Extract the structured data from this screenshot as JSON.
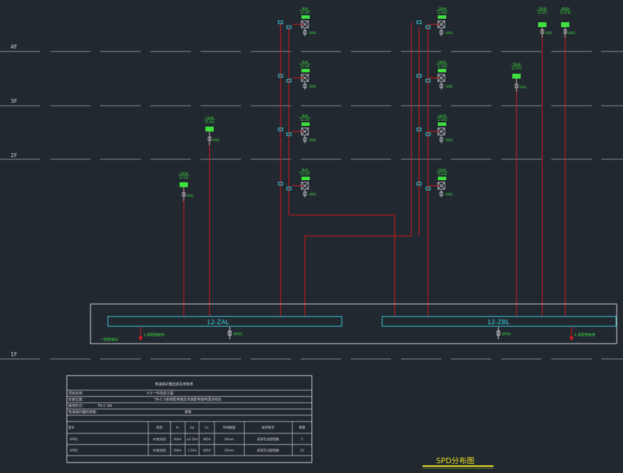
{
  "floors": [
    "4F",
    "3F",
    "2F",
    "1F"
  ],
  "bus_left": "12-ZAL",
  "bus_right": "12-ZBL",
  "tags": {
    "left_room": "1-变配电房用",
    "left_spd": "SPD1",
    "right_spd": "SPD1",
    "right_room": "1-变配电房用",
    "left_note": "一层配电间"
  },
  "boxes": {
    "b1": {
      "kw": "9kW",
      "id": "12-3AT",
      "spd": "SPD2"
    },
    "b2": {
      "kw": "9kW",
      "id": "12-3AT",
      "spd": "SPD2"
    },
    "b3": {
      "kw": "9kW",
      "id": "12-2AT",
      "spd": "SPD2"
    },
    "b4": {
      "kw": "9kW",
      "id": "12-1AT",
      "spd": "SPD2"
    },
    "b5": {
      "kw": "20kW",
      "id": "12-4AE",
      "spd": "SPD2"
    },
    "b6": {
      "kw": "20kW",
      "id": "12-3AE",
      "spd": "SPD2"
    },
    "b7": {
      "kw": "20kW",
      "id": "12-2AE",
      "spd": "SPD2"
    },
    "b8": {
      "kw": "20kW",
      "id": "12-1AE",
      "spd": "SPD2"
    },
    "b9": {
      "kw": "70kW",
      "id": "12-4TL",
      "spd": "SPD2"
    },
    "b10": {
      "kw": "40kW",
      "id": "12-4FW",
      "spd": "SPD2"
    },
    "b11": {
      "kw": "70kW",
      "id": "12-3TL",
      "spd": "SPD2"
    },
    "b12": {
      "kw": "15kW",
      "id": "12-2AL",
      "spd": "SPD2"
    },
    "b13": {
      "kw": "15kW",
      "id": "12-1AL",
      "spd": "SPD2"
    }
  },
  "table": {
    "title": "电涌保护器选择及参数表",
    "project_label": "项目名称：",
    "project_value": "X-X一中改造工程",
    "location_label": "安装位置：",
    "location_value": "TN-C-S系统配电箱及末端配电箱电源进线处",
    "system_label": "接地形式：",
    "system_value": "TN-C-SN",
    "param_label": "电涌保护器的参数：",
    "param_value": "参数",
    "headers": [
      "型号",
      "类别",
      "In",
      "Up",
      "Uc",
      "导线截面",
      "安装要求",
      "数量"
    ],
    "rows": [
      [
        "SPD1",
        "II/I类试验",
        "50kA",
        "≤2.5kV",
        "385V",
        "16mm",
        "安装在总配电箱",
        "5"
      ],
      [
        "SPD2",
        "II/I类试验",
        "20kA",
        "1.5kV",
        "385V",
        "10mm",
        "安装在分配电箱",
        "12"
      ]
    ]
  },
  "drawing_title": "SPD分布图"
}
